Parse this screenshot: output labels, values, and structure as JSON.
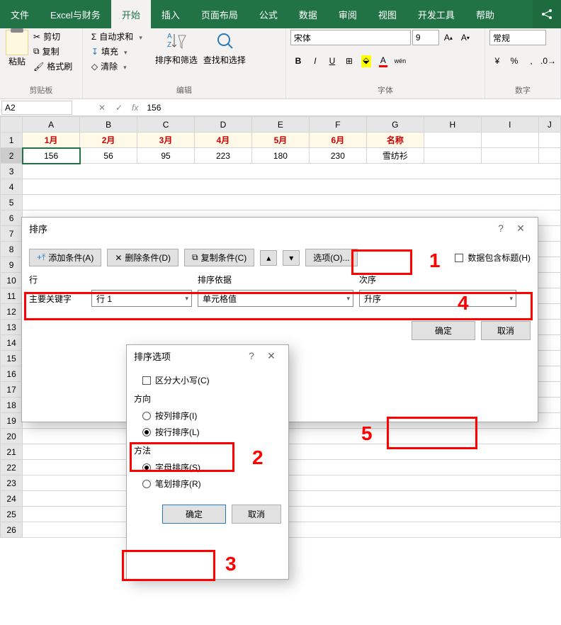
{
  "tabs": [
    "文件",
    "Excel与财务",
    "开始",
    "插入",
    "页面布局",
    "公式",
    "数据",
    "审阅",
    "视图",
    "开发工具",
    "帮助"
  ],
  "active_tab": "开始",
  "ribbon": {
    "clipboard": {
      "label": "剪贴板",
      "paste": "粘贴",
      "cut": "剪切",
      "copy": "复制",
      "format_painter": "格式刷"
    },
    "edit": {
      "label": "编辑",
      "autosum": "自动求和",
      "fill": "填充",
      "clear": "清除",
      "sort_filter": "排序和筛选",
      "find_select": "查找和选择"
    },
    "font": {
      "label": "字体",
      "name": "宋体",
      "size": "9"
    },
    "number": {
      "label": "数字",
      "format": "常规"
    }
  },
  "formula_bar": {
    "cell_ref": "A2",
    "value": "156"
  },
  "grid": {
    "columns": [
      "A",
      "B",
      "C",
      "D",
      "E",
      "F",
      "G",
      "H",
      "I",
      "J"
    ],
    "row_headers": [
      1,
      2,
      3,
      4,
      5,
      6,
      7,
      8,
      9,
      10,
      11,
      12,
      13,
      14,
      15,
      16,
      17,
      18,
      19,
      20,
      21,
      22,
      23,
      24,
      25,
      26
    ],
    "header_row": [
      "1月",
      "2月",
      "3月",
      "4月",
      "5月",
      "6月",
      "名称"
    ],
    "data_row": [
      "156",
      "56",
      "95",
      "223",
      "180",
      "230",
      "雪纺衫"
    ]
  },
  "sort_dialog": {
    "title": "排序",
    "add_cond": "添加条件(A)",
    "del_cond": "删除条件(D)",
    "copy_cond": "复制条件(C)",
    "options": "选项(O)...",
    "has_header": "数据包含标题(H)",
    "col_label_row": "行",
    "col_label_basis": "排序依据",
    "col_label_order": "次序",
    "primary_key_label": "主要关键字",
    "row_val": "行 1",
    "basis_val": "单元格值",
    "order_val": "升序",
    "ok": "确定",
    "cancel": "取消"
  },
  "sort_options": {
    "title": "排序选项",
    "case": "区分大小写(C)",
    "direction": "方向",
    "by_col": "按列排序(I)",
    "by_row": "按行排序(L)",
    "method": "方法",
    "alpha": "字母排序(S)",
    "stroke": "笔划排序(R)",
    "ok": "确定",
    "cancel": "取消"
  },
  "annotations": {
    "n1": "1",
    "n2": "2",
    "n3": "3",
    "n4": "4",
    "n5": "5"
  },
  "chart_data": {
    "type": "table",
    "categories": [
      "1月",
      "2月",
      "3月",
      "4月",
      "5月",
      "6月"
    ],
    "values": [
      156,
      56,
      95,
      223,
      180,
      230
    ],
    "name": "雪纺衫"
  }
}
